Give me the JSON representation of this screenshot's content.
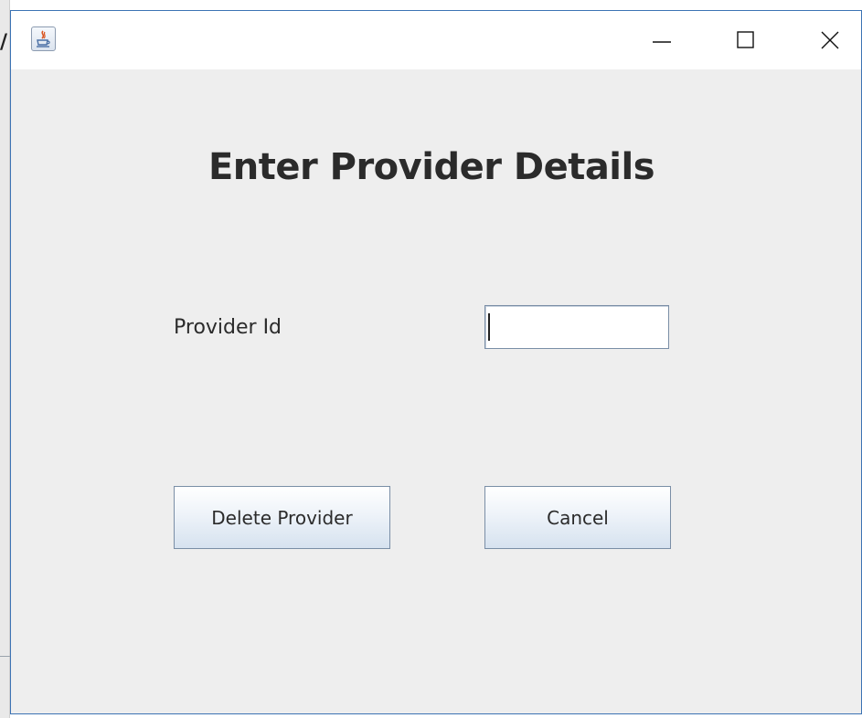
{
  "background": {
    "glyph": "/"
  },
  "window": {
    "icon": "java-cup-icon",
    "controls": {
      "minimize": "minimize-icon",
      "maximize": "maximize-icon",
      "close": "close-icon"
    }
  },
  "form": {
    "heading": "Enter Provider Details",
    "provider_id_label": "Provider Id",
    "provider_id_value": "",
    "delete_label": "Delete Provider",
    "cancel_label": "Cancel"
  },
  "colors": {
    "window_border": "#3c73b4",
    "window_bg": "#eeeeee",
    "button_border": "#7a8ea6"
  }
}
